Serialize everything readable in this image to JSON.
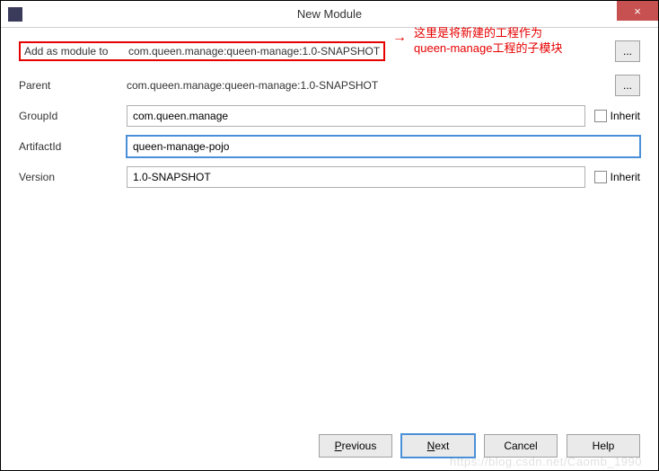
{
  "window": {
    "title": "New Module",
    "close_icon": "×"
  },
  "rows": {
    "add_as_module": {
      "label": "Add as module to",
      "value": "com.queen.manage:queen-manage:1.0-SNAPSHOT",
      "ellipsis": "..."
    },
    "parent": {
      "label": "Parent",
      "value": "com.queen.manage:queen-manage:1.0-SNAPSHOT",
      "ellipsis": "..."
    },
    "group_id": {
      "label": "GroupId",
      "value": "com.queen.manage",
      "inherit_label": "Inherit"
    },
    "artifact_id": {
      "label": "ArtifactId",
      "value": "queen-manage-pojo"
    },
    "version": {
      "label": "Version",
      "value": "1.0-SNAPSHOT",
      "inherit_label": "Inherit"
    }
  },
  "annotation": {
    "line1": "这里是将新建的工程作为",
    "line2": "queen-manage工程的子模块"
  },
  "buttons": {
    "previous_p": "P",
    "previous_rest": "revious",
    "next_n": "N",
    "next_rest": "ext",
    "cancel": "Cancel",
    "help": "Help"
  },
  "watermark": "https://blog.csdn.net/Caomb_1990"
}
